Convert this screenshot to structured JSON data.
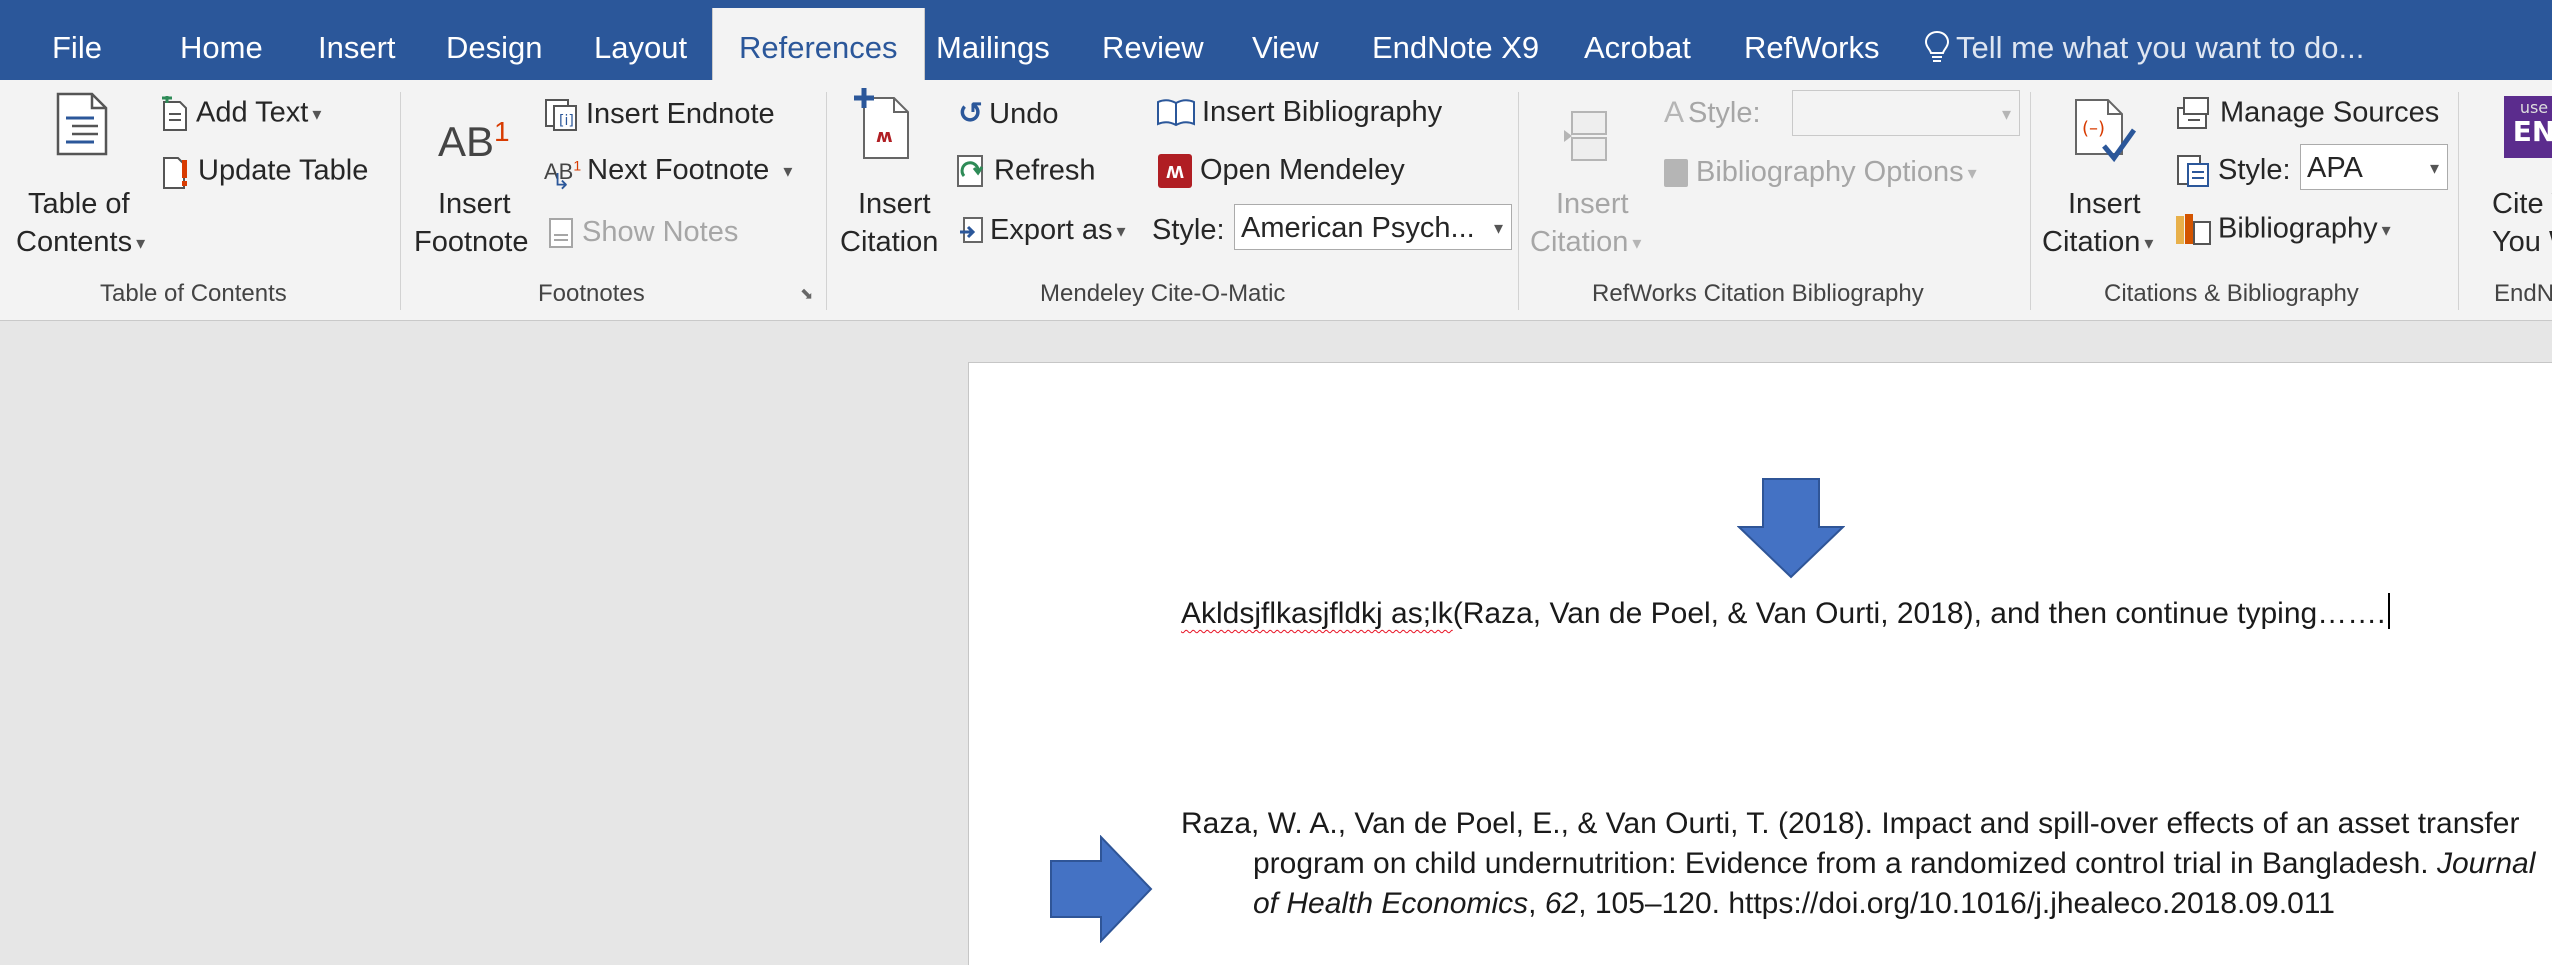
{
  "tabs": {
    "file": "File",
    "home": "Home",
    "insert": "Insert",
    "design": "Design",
    "layout": "Layout",
    "references": "References",
    "mailings": "Mailings",
    "review": "Review",
    "view": "View",
    "endnote": "EndNote X9",
    "acrobat": "Acrobat",
    "refworks": "RefWorks",
    "tellme": "Tell me what you want to do..."
  },
  "ribbon": {
    "toc": {
      "table_of": "Table of",
      "contents": "Contents",
      "add_text": "Add Text",
      "update_table": "Update Table",
      "group": "Table of Contents"
    },
    "footnotes": {
      "ab": "AB",
      "ab_sup": "1",
      "insert": "Insert",
      "footnote": "Footnote",
      "insert_endnote": "Insert Endnote",
      "next_footnote": "Next Footnote",
      "show_notes": "Show Notes",
      "group": "Footnotes"
    },
    "mendeley": {
      "insert": "Insert",
      "citation": "Citation",
      "undo": "Undo",
      "refresh": "Refresh",
      "export_as": "Export as",
      "insert_bibliography": "Insert Bibliography",
      "open_mendeley": "Open Mendeley",
      "style_label": "Style:",
      "style_value": "American Psych...",
      "group": "Mendeley Cite-O-Matic"
    },
    "refworks": {
      "insert": "Insert",
      "citation": "Citation",
      "style_label": "Style:",
      "bibliography_options": "Bibliography Options",
      "group": "RefWorks Citation  Bibliography"
    },
    "citations": {
      "insert": "Insert",
      "citation": "Citation",
      "manage_sources": "Manage Sources",
      "style_label": "Style:",
      "style_value": "APA",
      "bibliography": "Bibliography",
      "group": "Citations & Bibliography"
    },
    "endnote": {
      "badge_top": "use",
      "badge_bottom": "EN",
      "cite_while": "Cite W",
      "you_write": "You W",
      "group": "EndN"
    }
  },
  "document": {
    "line1_misspelled": "Akldsjflkasjfldkj as;lk",
    "line1_rest": "(Raza, Van de Poel, & Van Ourti, 2018), and then continue typing…….",
    "ref_line1": "Raza, W. A., Van de Poel, E., & Van Ourti, T. (2018). Impact and spill-over effects of an asset transfer",
    "ref_line2_a": "program on child undernutrition: Evidence from a randomized control trial in Bangladesh. ",
    "ref_line2_b": "Journal",
    "ref_line3_a": "of Health Economics",
    "ref_line3_b": ", ",
    "ref_line3_c": "62",
    "ref_line3_d": ", 105–120. https://doi.org/10.1016/j.jhealeco.2018.09.011"
  },
  "colors": {
    "tab_blue": "#2b579a",
    "ribbon_bg": "#f3f3f3",
    "arrow_blue": "#4472c4",
    "mendeley_red": "#b01e23"
  }
}
